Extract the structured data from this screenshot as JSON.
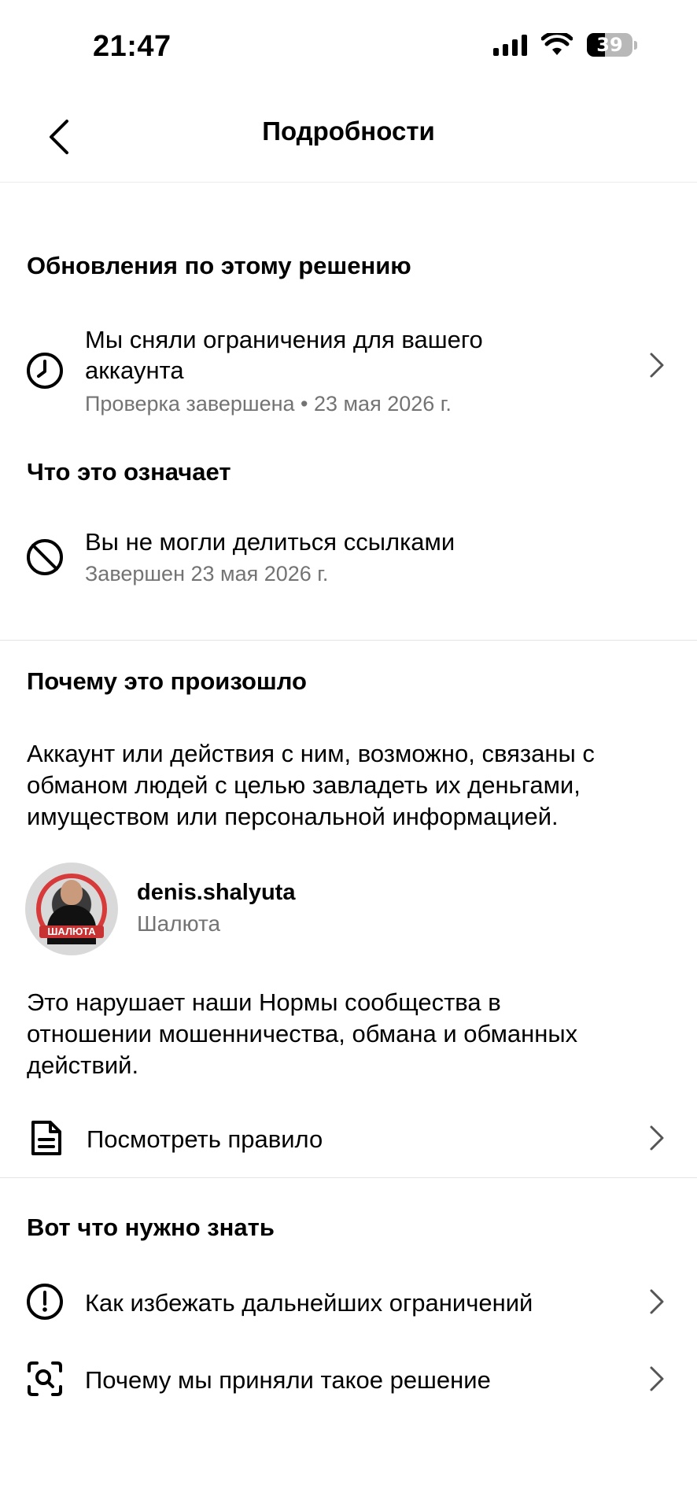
{
  "status_bar": {
    "time": "21:47",
    "battery": "39"
  },
  "header": {
    "title": "Подробности"
  },
  "updates": {
    "title": "Обновления по этому решению",
    "item": {
      "line1": "Мы сняли ограничения для вашего",
      "line2": "аккаунта",
      "sub": "Проверка завершена • 23 мая 2026 г."
    }
  },
  "meaning": {
    "title": "Что это означает",
    "item": {
      "main": "Вы не могли делиться ссылками",
      "sub": "Завершен 23 мая 2026 г."
    }
  },
  "why": {
    "title": "Почему это произошло",
    "paragraph_lines": [
      "Аккаунт или действия с ним, возможно, связаны с",
      "обманом людей с целью завладеть их деньгами,",
      "имуществом или персональной информацией."
    ],
    "account": {
      "username": "denis.shalyuta",
      "name": "Шалюта",
      "avatar_label": "ШАЛЮТА"
    },
    "violation_lines": [
      "Это нарушает наши Нормы сообщества в",
      "отношении мошенничества, обмана и обманных",
      "действий."
    ],
    "rule_link": "Посмотреть правило"
  },
  "know": {
    "title": "Вот что нужно знать",
    "items": [
      {
        "label": "Как избежать дальнейших ограничений",
        "icon": "alert-circle-icon"
      },
      {
        "label": "Почему мы приняли такое решение",
        "icon": "scan-search-icon"
      }
    ]
  }
}
